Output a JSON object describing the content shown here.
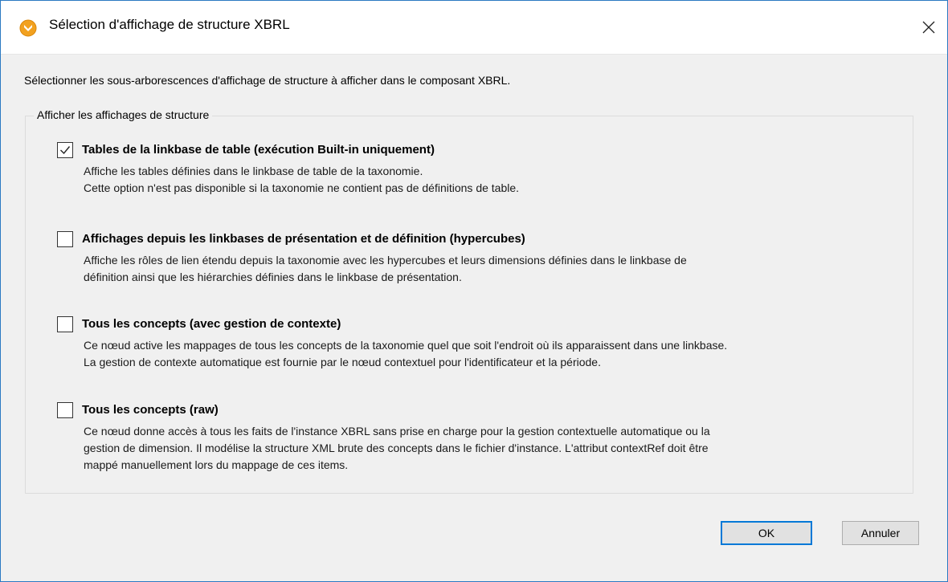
{
  "window": {
    "title": "Sélection d'affichage de structure XBRL",
    "accent_color": "#2b79c2",
    "app_icon": "altova-logo-icon",
    "close_icon": "close-icon"
  },
  "instruction": "Sélectionner les sous-arborescences d'affichage de structure à afficher dans le composant XBRL.",
  "group": {
    "legend": "Afficher les affichages de structure",
    "options": [
      {
        "label": "Tables de la linkbase de table (exécution Built-in uniquement)",
        "checked": true,
        "desc": [
          "Affiche les tables définies dans le linkbase de table de la taxonomie.",
          "Cette option n'est pas disponible si la taxonomie ne contient pas de définitions de table."
        ]
      },
      {
        "label": "Affichages depuis les linkbases de présentation et de définition (hypercubes)",
        "checked": false,
        "desc": [
          "Affiche les rôles de lien étendu depuis la taxonomie avec les hypercubes et leurs dimensions définies dans le linkbase de",
          "définition ainsi que les hiérarchies définies dans le linkbase de présentation."
        ]
      },
      {
        "label": "Tous les concepts (avec gestion de contexte)",
        "checked": false,
        "desc": [
          "Ce nœud active les mappages de tous les concepts de la taxonomie quel que soit l'endroit où ils apparaissent dans une linkbase.",
          "La gestion de contexte automatique est fournie par le nœud contextuel pour l'identificateur et la période."
        ]
      },
      {
        "label": "Tous les concepts (raw)",
        "checked": false,
        "desc": [
          "Ce nœud donne accès à tous les faits de l'instance XBRL sans prise en charge pour la gestion contextuelle automatique ou la",
          "gestion de dimension. Il modélise la structure XML brute des concepts dans le fichier d'instance. L'attribut contextRef doit être",
          "mappé manuellement lors du mappage de ces items."
        ]
      }
    ]
  },
  "buttons": {
    "ok": "OK",
    "cancel": "Annuler"
  }
}
